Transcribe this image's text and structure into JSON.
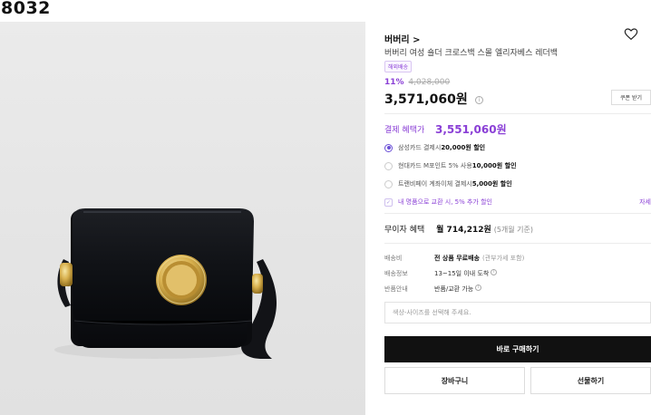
{
  "page_id": "8032",
  "product": {
    "brand": "버버리 >",
    "name": "버버리 여성 숄더 크로스백 스몰 엘리자베스 레더백",
    "tag": "해외배송",
    "discount_rate": "11%",
    "original_price": "4,028,000",
    "price": "3,571,060원",
    "coupon_label": "쿠폰 받기"
  },
  "benefits": {
    "title": "결제 혜택가",
    "price": "3,551,060원",
    "options": [
      {
        "text": "삼성카드 결제시 ",
        "amount": "20,000원 할인",
        "selected": true
      },
      {
        "text": "현대카드 M포인트 5% 사용 ",
        "amount": "10,000원 할인",
        "selected": false
      },
      {
        "text": "트랜비페이 계좌이체 결제시 ",
        "amount": "5,000원 할인",
        "selected": false
      }
    ],
    "trade_in": "내 명품으로 교환 시, 5% 추가 할인",
    "detail_link": "자세"
  },
  "installment": {
    "label": "무이자 혜택",
    "value": "월 714,212원",
    "note": "(5개월 기준)"
  },
  "shipping": [
    {
      "label": "배송비",
      "value": "전 상품 무료배송",
      "note": "(관부가세 포함)"
    },
    {
      "label": "배송정보",
      "value": "13~15일 이내 도착",
      "note": ""
    },
    {
      "label": "반품안내",
      "value": "반품/교환 가능",
      "note": ""
    }
  ],
  "option_select": {
    "placeholder": "색상-사이즈를 선택해 주세요."
  },
  "actions": {
    "buy": "바로 구매하기",
    "cart": "장바구니",
    "gift": "선물하기"
  },
  "icons": {
    "wishlist": "heart-outline-icon",
    "info": "info-circle-icon"
  },
  "colors": {
    "accent": "#8a3fd6",
    "buy_button": "#111111"
  }
}
